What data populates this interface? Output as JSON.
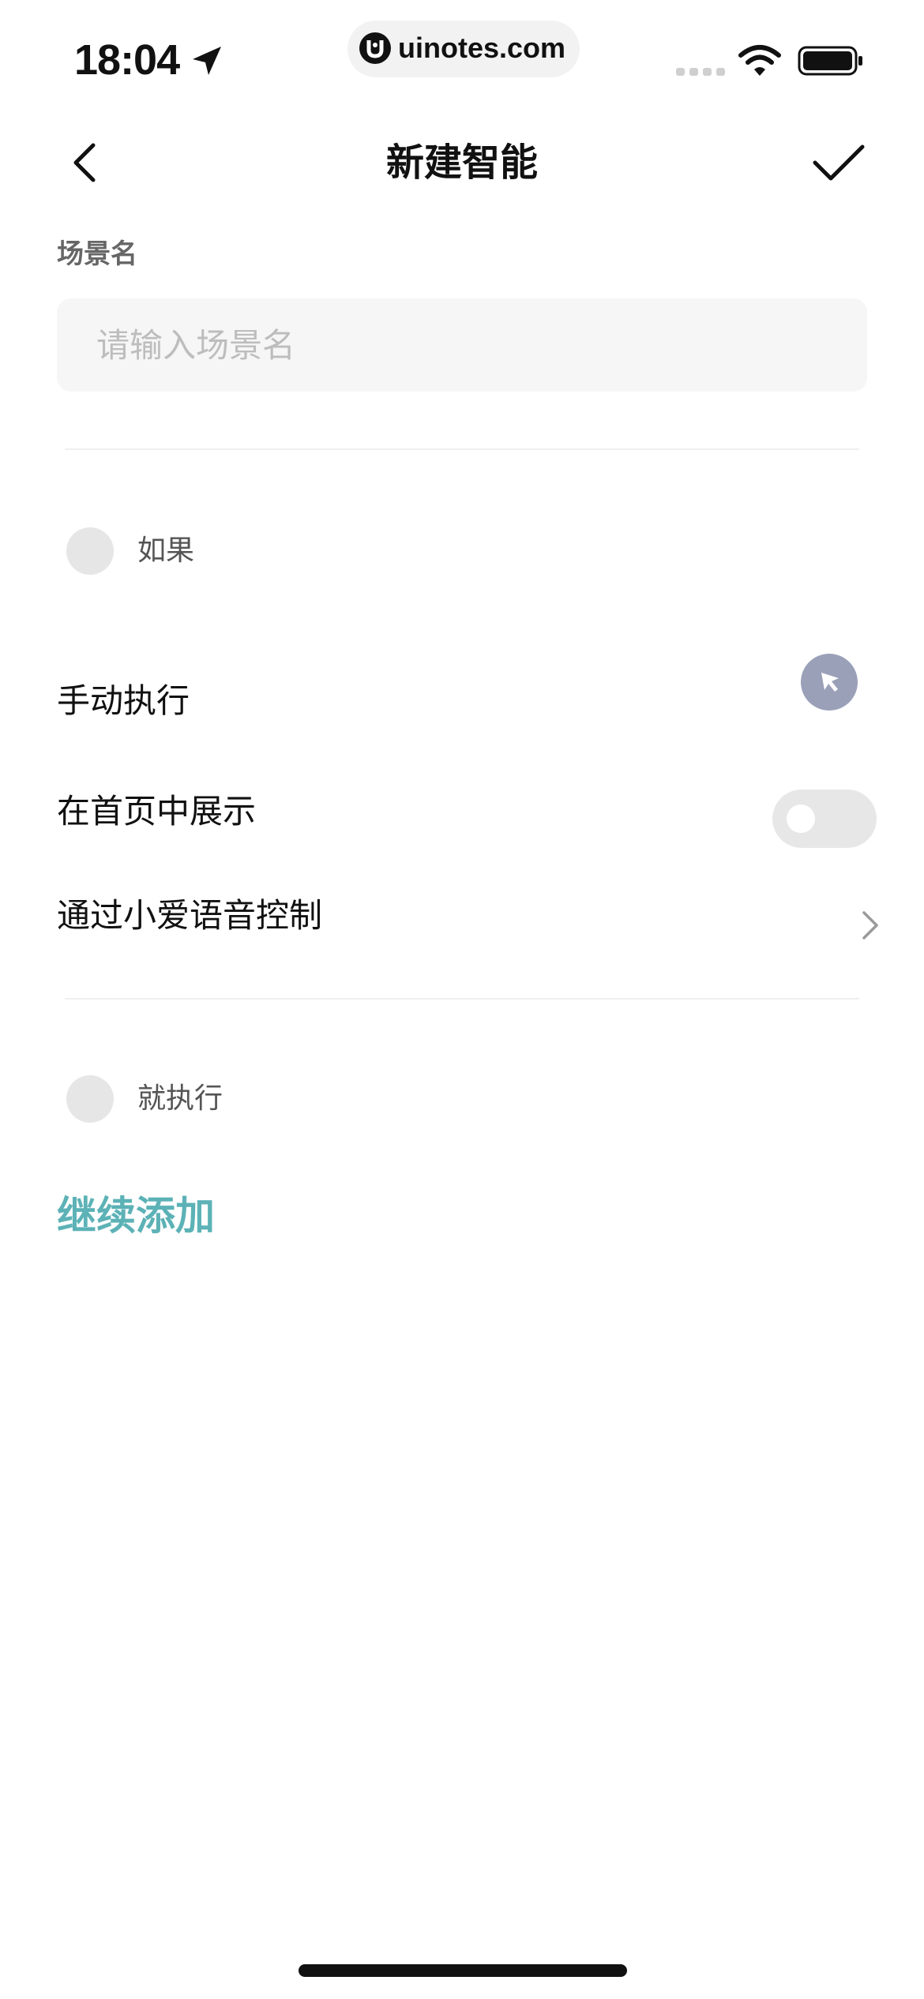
{
  "status_bar": {
    "time": "18:04",
    "url": "uinotes.com"
  },
  "nav": {
    "title": "新建智能"
  },
  "scene_name": {
    "label": "场景名",
    "placeholder": "请输入场景名",
    "value": ""
  },
  "if_section": {
    "label": "如果"
  },
  "conditions": {
    "manual": "手动执行",
    "show_on_home": "在首页中展示",
    "show_on_home_enabled": false,
    "voice_control": "通过小爱语音控制"
  },
  "then_section": {
    "label": "就执行"
  },
  "add_more": "继续添加",
  "colors": {
    "accent": "#5cb2b6",
    "manual_icon_bg": "#9aa0b8",
    "input_bg": "#f6f6f6",
    "toggle_bg": "#e7e7e7"
  },
  "icons": {
    "back": "chevron-left-icon",
    "confirm": "checkmark-icon",
    "manual": "cursor-click-icon",
    "voice_arrow": "chevron-right-icon"
  }
}
